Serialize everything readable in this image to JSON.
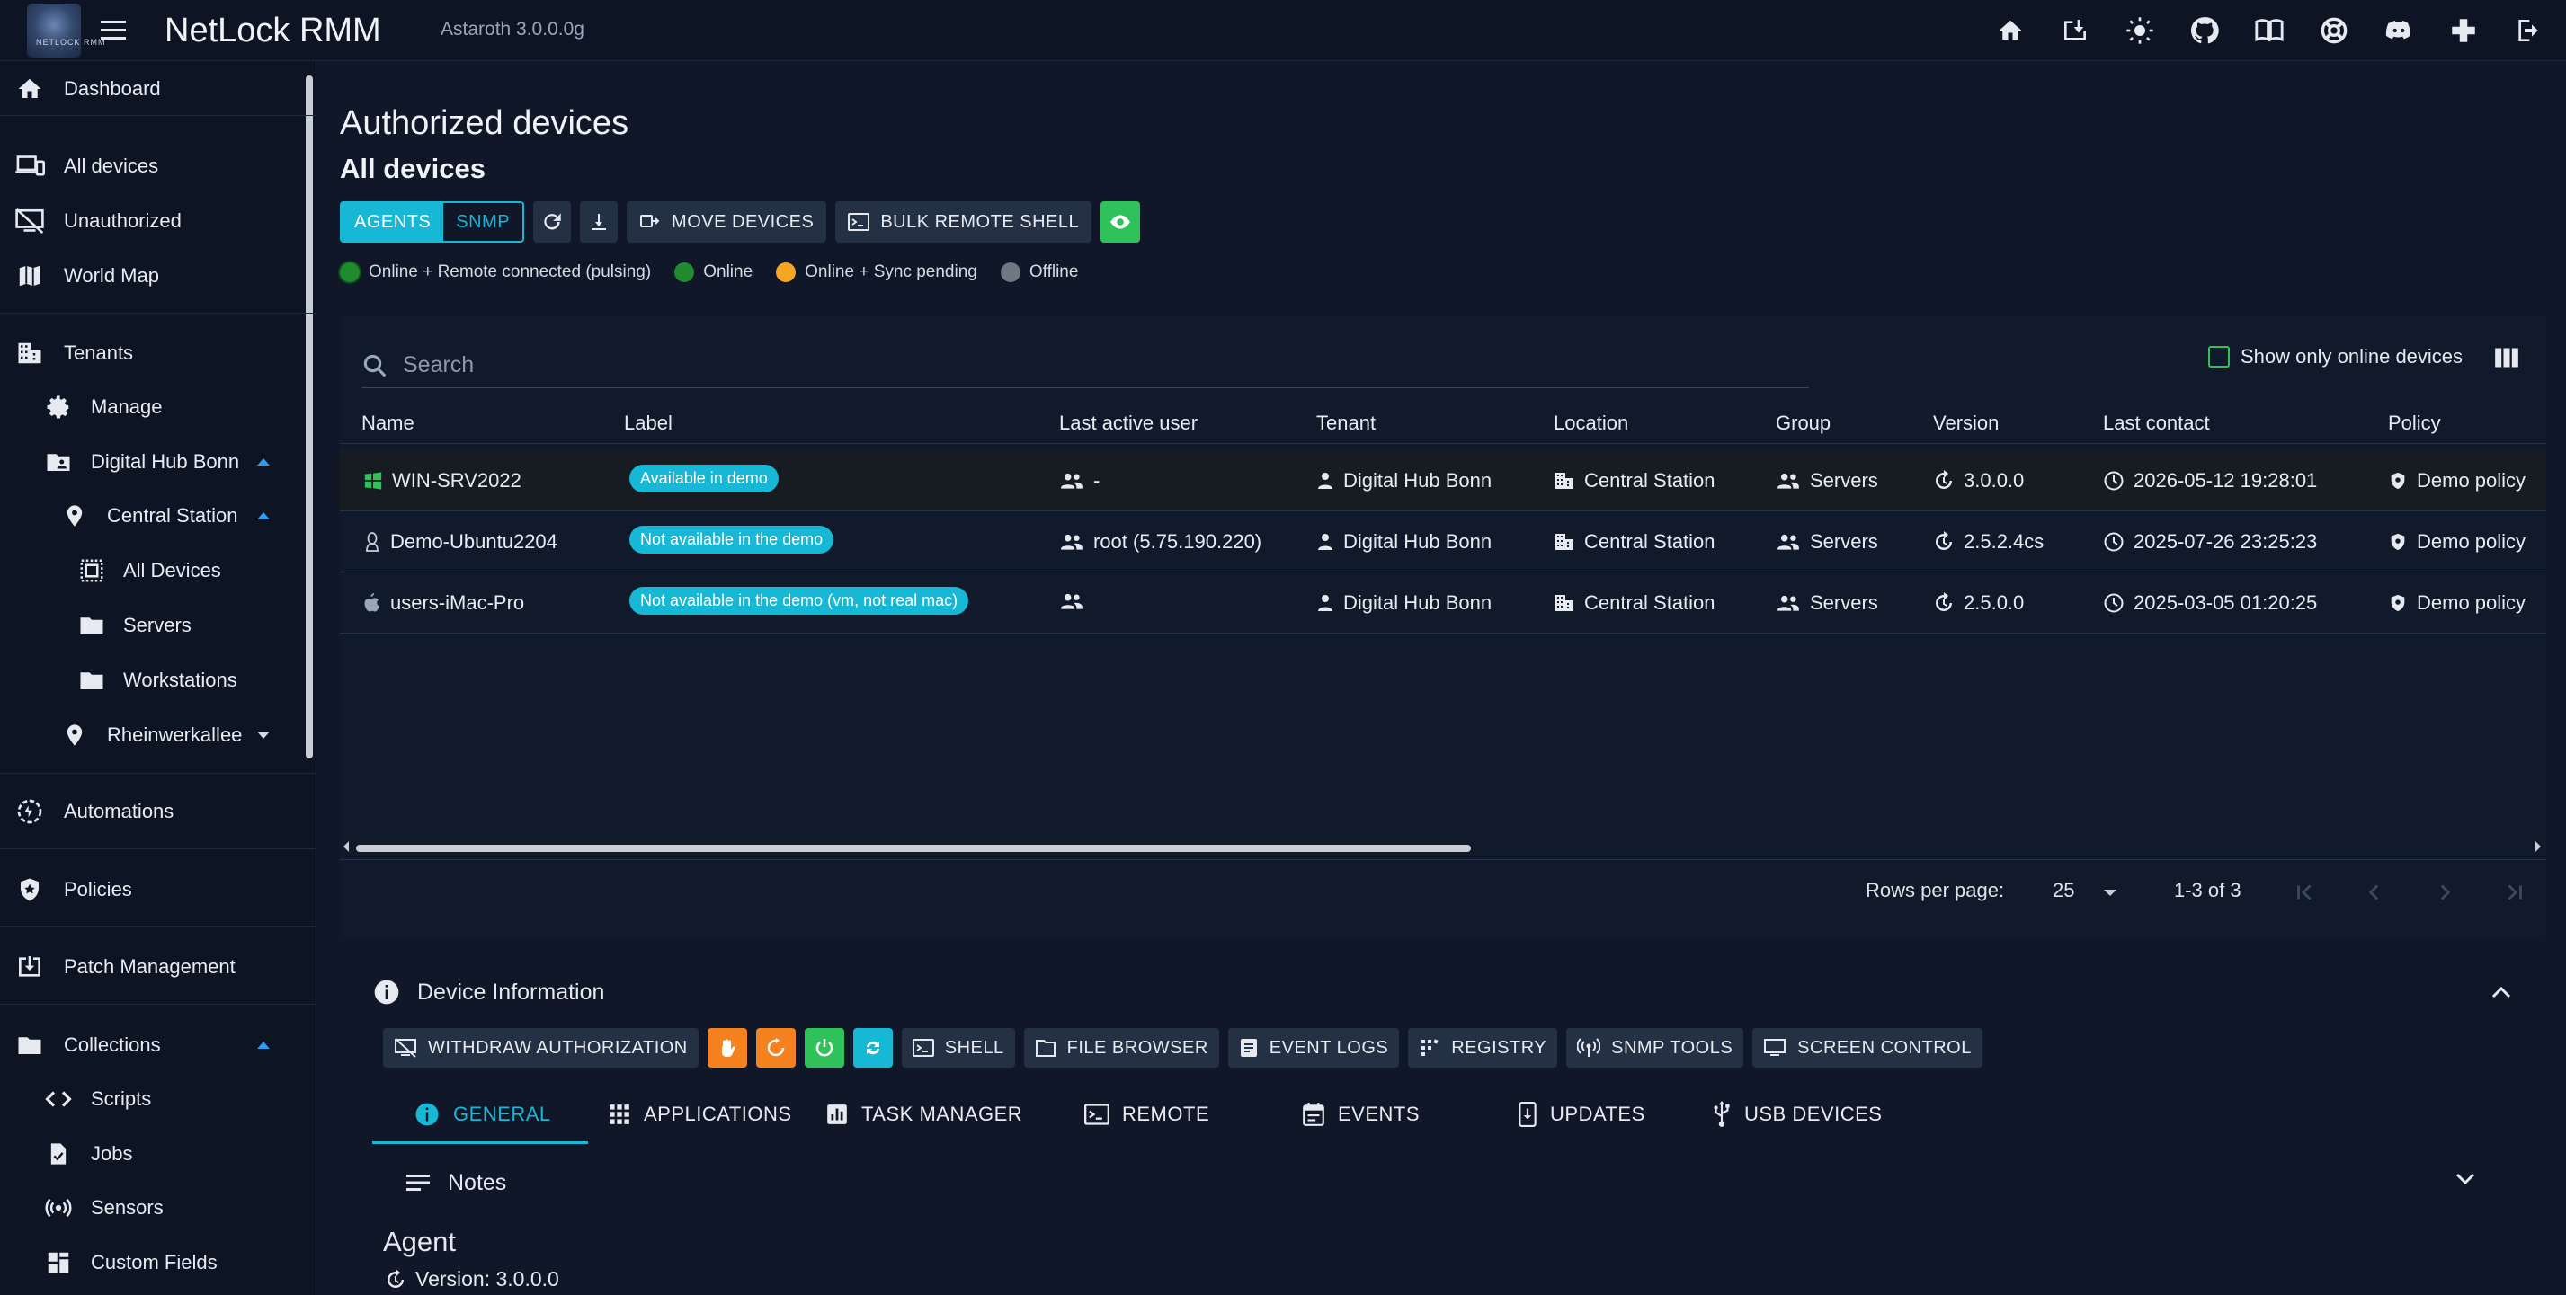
{
  "app": {
    "title": "NetLock RMM",
    "version": "Astaroth 3.0.0.0g",
    "logo_text": "NETLOCK RMM"
  },
  "sidebar": {
    "dashboard": "Dashboard",
    "all_devices": "All devices",
    "unauthorized": "Unauthorized",
    "world_map": "World Map",
    "tenants": "Tenants",
    "manage": "Manage",
    "tenant_digital_hub": "Digital Hub Bonn",
    "location_central": "Central Station",
    "group_all_devices": "All Devices",
    "group_servers": "Servers",
    "group_workstations": "Workstations",
    "location_rhein": "Rheinwerkallee",
    "automations": "Automations",
    "policies": "Policies",
    "patch_management": "Patch Management",
    "collections": "Collections",
    "scripts": "Scripts",
    "jobs": "Jobs",
    "sensors": "Sensors",
    "custom_fields": "Custom Fields"
  },
  "main": {
    "title": "Authorized devices",
    "subtitle": "All devices",
    "toggle": {
      "agents": "AGENTS",
      "snmp": "SNMP"
    },
    "move_devices": "MOVE DEVICES",
    "bulk_remote_shell": "BULK REMOTE SHELL",
    "legend": [
      {
        "label": "Online + Remote connected (pulsing)",
        "color": "#1f8a2e"
      },
      {
        "label": "Online",
        "color": "#1f8a2e"
      },
      {
        "label": "Online + Sync pending",
        "color": "#f5a623"
      },
      {
        "label": "Offline",
        "color": "#6f7782"
      }
    ],
    "search_placeholder": "Search",
    "show_online_only": "Show only online devices"
  },
  "table": {
    "headers": [
      "Name",
      "Label",
      "Last active user",
      "Tenant",
      "Location",
      "Group",
      "Version",
      "Last contact",
      "Policy"
    ],
    "rows": [
      {
        "os": "windows-icon",
        "name": "WIN-SRV2022",
        "label": "Available in demo",
        "user": "-",
        "tenant": "Digital Hub Bonn",
        "location": "Central Station",
        "group": "Servers",
        "version": "3.0.0.0",
        "last_contact": "2026-05-12 19:28:01",
        "policy": "Demo policy"
      },
      {
        "os": "linux-icon",
        "name": "Demo-Ubuntu2204",
        "label": "Not available in the demo",
        "user": "root (5.75.190.220)",
        "tenant": "Digital Hub Bonn",
        "location": "Central Station",
        "group": "Servers",
        "version": "2.5.2.4cs",
        "last_contact": "2025-07-26 23:25:23",
        "policy": "Demo policy"
      },
      {
        "os": "apple-icon",
        "name": "users-iMac-Pro",
        "label": "Not available in the demo (vm, not real mac)",
        "user": "",
        "tenant": "Digital Hub Bonn",
        "location": "Central Station",
        "group": "Servers",
        "version": "2.5.0.0",
        "last_contact": "2025-03-05 01:20:25",
        "policy": "Demo policy"
      }
    ],
    "rows_per_page_label": "Rows per page:",
    "rows_per_page": "25",
    "range": "1-3 of 3"
  },
  "device_info": {
    "title": "Device Information",
    "withdraw": "WITHDRAW AUTHORIZATION",
    "shell": "SHELL",
    "file_browser": "FILE BROWSER",
    "event_logs": "EVENT LOGS",
    "registry": "REGISTRY",
    "snmp_tools": "SNMP TOOLS",
    "screen_control": "SCREEN CONTROL",
    "tabs": [
      "GENERAL",
      "APPLICATIONS",
      "TASK MANAGER",
      "REMOTE",
      "EVENTS",
      "UPDATES",
      "USB DEVICES"
    ],
    "notes": "Notes",
    "agent_heading": "Agent",
    "agent_version": "Version: 3.0.0.0"
  },
  "colors": {
    "accent": "#17b7d6",
    "green": "#2fc25b",
    "orange": "#f5811f",
    "background": "#0f1728"
  }
}
